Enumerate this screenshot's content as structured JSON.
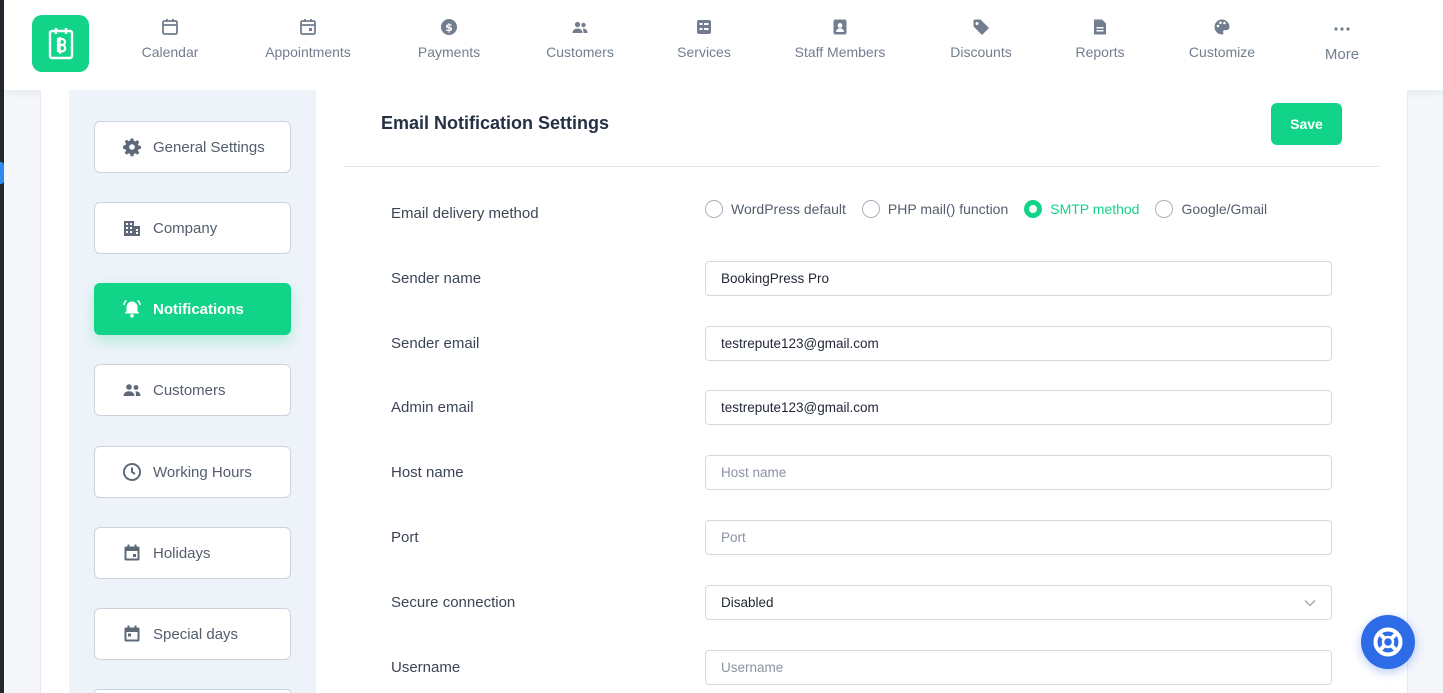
{
  "colors": {
    "accent": "#12d488",
    "help": "#2e6be6",
    "text": "#2f3a4b"
  },
  "nav": {
    "logo_icon": "bookingpress-logo-icon",
    "items": [
      {
        "label": "Calendar",
        "icon": "calendar-icon"
      },
      {
        "label": "Appointments",
        "icon": "appointments-icon"
      },
      {
        "label": "Payments",
        "icon": "dollar-icon"
      },
      {
        "label": "Customers",
        "icon": "people-icon"
      },
      {
        "label": "Services",
        "icon": "services-icon"
      },
      {
        "label": "Staff Members",
        "icon": "staff-badge-icon"
      },
      {
        "label": "Discounts",
        "icon": "tag-icon"
      },
      {
        "label": "Reports",
        "icon": "report-icon"
      },
      {
        "label": "Customize",
        "icon": "palette-icon"
      },
      {
        "label": "More",
        "icon": "more-dots-icon"
      }
    ]
  },
  "sidebar": {
    "items": [
      {
        "label": "General Settings",
        "icon": "gear-icon"
      },
      {
        "label": "Company",
        "icon": "building-icon"
      },
      {
        "label": "Notifications",
        "icon": "bell-icon",
        "active": true
      },
      {
        "label": "Customers",
        "icon": "people-icon"
      },
      {
        "label": "Working Hours",
        "icon": "clock-icon"
      },
      {
        "label": "Holidays",
        "icon": "calendar-icon"
      },
      {
        "label": "Special days",
        "icon": "calendar-icon"
      }
    ]
  },
  "main": {
    "title": "Email Notification Settings",
    "save_label": "Save",
    "delivery": {
      "label": "Email delivery method",
      "options": [
        "WordPress default",
        "PHP mail() function",
        "SMTP method",
        "Google/Gmail"
      ],
      "selected": "SMTP method"
    },
    "fields": {
      "sender_name": {
        "label": "Sender name",
        "value": "BookingPress Pro",
        "placeholder": ""
      },
      "sender_email": {
        "label": "Sender email",
        "value": "testrepute123@gmail.com",
        "placeholder": ""
      },
      "admin_email": {
        "label": "Admin email",
        "value": "testrepute123@gmail.com",
        "placeholder": ""
      },
      "host_name": {
        "label": "Host name",
        "value": "",
        "placeholder": "Host name"
      },
      "port": {
        "label": "Port",
        "value": "",
        "placeholder": "Port"
      },
      "secure": {
        "label": "Secure connection",
        "value": "Disabled"
      },
      "username": {
        "label": "Username",
        "value": "",
        "placeholder": "Username"
      }
    }
  },
  "help_icon": "lifebuoy-icon"
}
